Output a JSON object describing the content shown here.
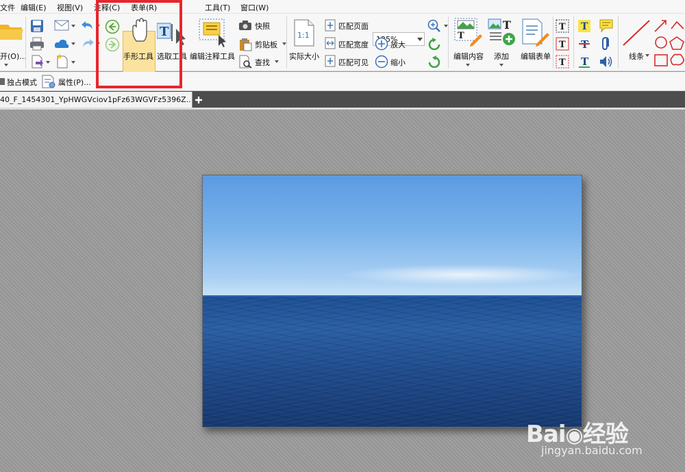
{
  "menu": {
    "items": [
      "文件",
      "编辑(E)",
      "视图(V)",
      "注释(C)",
      "表单(R)",
      "工具(T)",
      "窗口(W)"
    ]
  },
  "ribbon": {
    "open_label": "开(O)...",
    "hand_tool": "手形工具",
    "select_tool": "选取工具",
    "edit_annotation_tool": "编辑注释工具",
    "snapshot": "快照",
    "clipboard": "剪贴板",
    "find": "查找",
    "actual_size": "实际大小",
    "fit_page": "匹配页面",
    "fit_width": "匹配宽度",
    "fit_visible": "匹配可见",
    "zoom_value": "125%",
    "zoom_in": "放大",
    "zoom_out": "缩小",
    "edit_content": "编辑内容",
    "add": "添加",
    "edit_form": "编辑表单",
    "line": "线条"
  },
  "toolbar2": {
    "exclusive_mode": "独占模式",
    "properties": "属性(P)..."
  },
  "tabs": [
    {
      "label": "40_F_1454301_YpHWGVciov1pFz63WGVFz5396Z..",
      "close": "×"
    }
  ],
  "watermark": {
    "logo_text": "Bai",
    "logo_suffix": "经验",
    "url": "jingyan.baidu.com"
  }
}
